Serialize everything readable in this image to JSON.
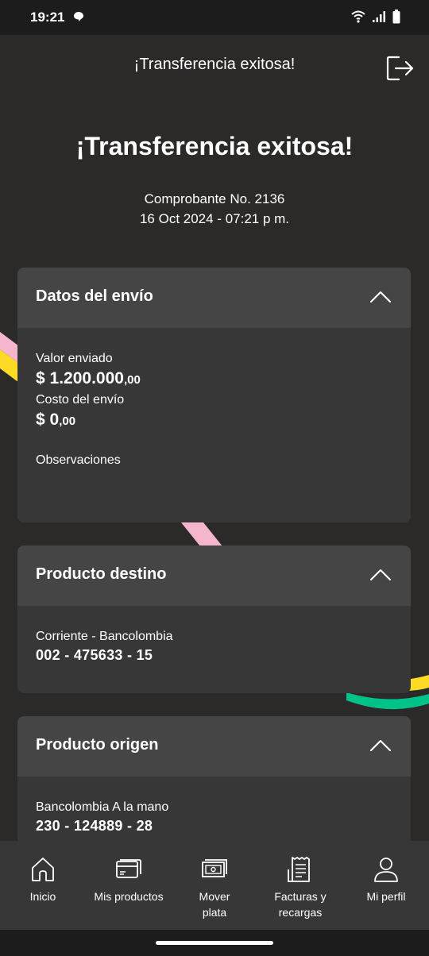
{
  "status": {
    "time": "19:21"
  },
  "header": {
    "title": "¡Transferencia exitosa!"
  },
  "hero": {
    "title": "¡Transferencia exitosa!",
    "voucher": "Comprobante No. 2136",
    "datetime": "16 Oct 2024 - 07:21 p m."
  },
  "envio": {
    "title": "Datos del envío",
    "valor_label": "Valor enviado",
    "valor_int": "$ 1.200.000",
    "valor_cents": ",00",
    "costo_label": "Costo del envío",
    "costo_int": "$ 0",
    "costo_cents": ",00",
    "obs_label": "Observaciones"
  },
  "destino": {
    "title": "Producto destino",
    "account_type": "Corriente - Bancolombia",
    "account_number": "002 - 475633 - 15"
  },
  "origen": {
    "title": "Producto origen",
    "account_type": "Bancolombia A la mano",
    "account_number": "230 - 124889 - 28"
  },
  "nav": {
    "inicio": "Inicio",
    "productos": "Mis productos",
    "mover_1": "Mover",
    "mover_2": "plata",
    "facturas_1": "Facturas y",
    "facturas_2": "recargas",
    "perfil": "Mi perfil"
  },
  "colors": {
    "background": "#2b2a29",
    "card": "#373737",
    "card_header": "#454545",
    "accent_yellow": "#fdda24",
    "accent_pink": "#f5b6cd",
    "accent_green": "#00c389"
  }
}
